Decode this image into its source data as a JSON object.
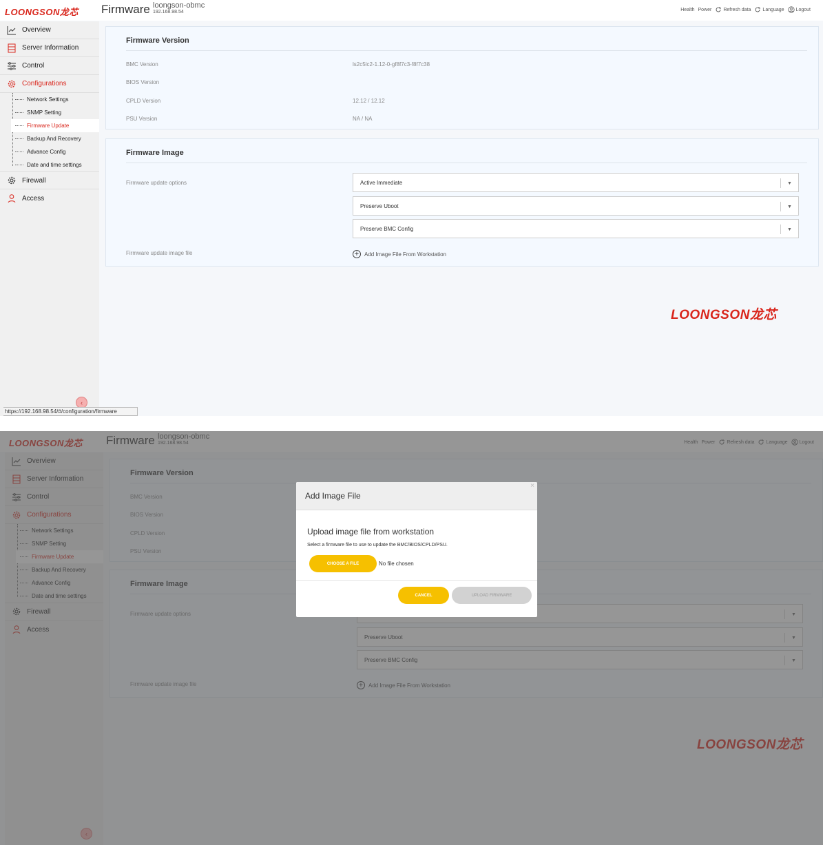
{
  "brand": "LOONGSON龙芯",
  "header": {
    "title": "Firmware",
    "hostname": "loongson-obmc",
    "ip": "192.168.98.54",
    "nav": [
      "Health",
      "Power",
      "Refresh data",
      "Language",
      "Logout"
    ]
  },
  "sidebar": {
    "items": [
      "Overview",
      "Server Information",
      "Control",
      "Configurations",
      "Firewall",
      "Access"
    ],
    "sub_items": [
      "Network Settings",
      "SNMP Setting",
      "Firmware Update",
      "Backup And Recovery",
      "Advance Config",
      "Date and time settings"
    ],
    "selected_sub": "Firmware Update",
    "collapse_icon": "chevron-left-icon"
  },
  "firmware_version": {
    "title": "Firmware Version",
    "rows": [
      {
        "label": "BMC Version",
        "value": "ls2c5lc2-1.12-0-gf8f7c3-f8f7c38"
      },
      {
        "label": "BIOS Version",
        "value": ""
      },
      {
        "label": "CPLD Version",
        "value": "12.12 / 12.12"
      },
      {
        "label": "PSU Version",
        "value": "NA / NA"
      }
    ]
  },
  "firmware_image": {
    "title": "Firmware Image",
    "options_label": "Firmware update options",
    "options": [
      "Active Immediate",
      "Preserve Uboot",
      "Preserve BMC Config"
    ],
    "file_label": "Firmware update image file",
    "add_file": "Add Image File From Workstation"
  },
  "status_url": "https://192.168.98.54/#/configuration/firmware",
  "modal": {
    "title": "Add Image File",
    "close": "×",
    "heading": "Upload image file from workstation",
    "desc": "Select a firmware file to use to update the BMC/BIOS/CPLD/PSU.",
    "choose": "CHOOSE A FILE",
    "no_file": "No file chosen",
    "cancel": "CANCEL",
    "upload": "UPLOAD FIRMWARE"
  },
  "colors": {
    "brand": "#d9261c",
    "accent": "#f6c000"
  }
}
